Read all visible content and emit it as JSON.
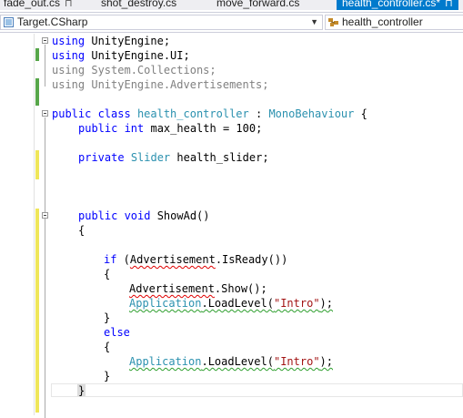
{
  "tabs": [
    {
      "label": "fade_out.cs",
      "close": "⊓"
    },
    {
      "label": "shot_destroy.cs"
    },
    {
      "label": "move_forward.cs"
    },
    {
      "label": "health_controller.cs*",
      "close": "⊓"
    }
  ],
  "nav": {
    "left_label": "Target.CSharp",
    "right_label": "health_controller",
    "left_icon": "csharp-project-icon",
    "right_icon": "class-icon"
  },
  "code": {
    "l1": {
      "kw": "using",
      "rest": " UnityEngine;"
    },
    "l2": {
      "kw": "using",
      "rest": " UnityEngine.UI;"
    },
    "l3": {
      "kw": "using",
      "rest": " System.Collections;"
    },
    "l4": {
      "kw": "using",
      "rest": " UnityEngine.Advertisements;"
    },
    "l5": {
      "kw": "public class",
      "type": "health_controller",
      "sep": " : ",
      "base": "MonoBehaviour",
      "end": " {"
    },
    "l6": {
      "kw": "public int",
      "rest": " max_health = 100;"
    },
    "l7": {
      "kw": "private",
      "type": "Slider",
      "rest": " health_slider;"
    },
    "l8": {
      "kw": "public void",
      "rest": " ShowAd()"
    },
    "l9": "{",
    "l10": {
      "kw": "if",
      "pre": " (",
      "call": "Advertisement",
      "rest": ".IsReady())"
    },
    "l11": "{",
    "l12": {
      "call": "Advertisement",
      "rest": ".Show();"
    },
    "l13": {
      "type": "Application",
      "mid": ".LoadLevel(",
      "str": "\"Intro\"",
      "end": ");"
    },
    "l14": "}",
    "l15": {
      "kw": "else"
    },
    "l16": "{",
    "l17": {
      "type": "Application",
      "mid": ".LoadLevel(",
      "str": "\"Intro\"",
      "end": ");"
    },
    "l18": "}",
    "l19": "}"
  },
  "colors": {
    "keyword": "#0000ff",
    "type": "#2b91af",
    "string": "#a31515",
    "unused_using": "#808080",
    "saved_change": "#57a64a",
    "unsaved_change": "#efe65a",
    "active_tab": "#007acc"
  }
}
